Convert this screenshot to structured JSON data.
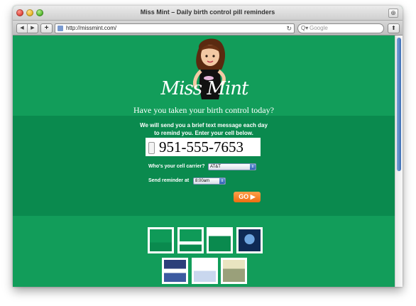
{
  "window": {
    "title": "Miss Mint – Daily birth control pill reminders"
  },
  "toolbar": {
    "back_icon": "back-arrow",
    "forward_icon": "forward-arrow",
    "add_label": "+",
    "url": "http://missmint.com/",
    "search_placeholder": "Google"
  },
  "page": {
    "logo": "Miss Mint",
    "tagline": "Have you taken your birth control today?",
    "instructions": "We will send you a brief text message each day to remind you. Enter your cell below.",
    "phone_value": "951-555-7653",
    "carrier_label": "Who's your cell carrier?",
    "carrier_selected": "AT&T",
    "reminder_label": "Send reminder at",
    "reminder_selected": "8:00am",
    "go_label": "GO"
  },
  "colors": {
    "page_bg": "#129d5a",
    "band_bg": "#0a8a4e",
    "go_button": "#f28020"
  }
}
